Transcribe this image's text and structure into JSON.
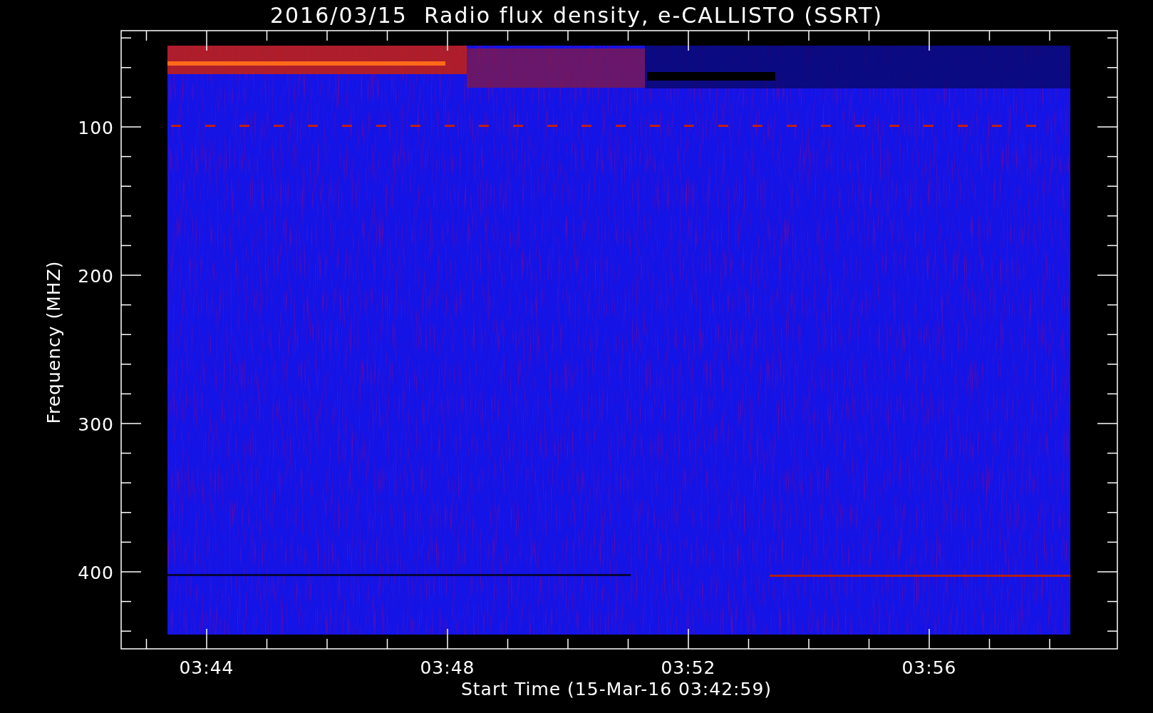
{
  "plot": {
    "title": "2016/03/15  Radio flux density, e-CALLISTO (SSRT)",
    "ylabel": "Frequency (MHZ)",
    "xlabel": "Start Time (15-Mar-16 03:42:59)",
    "yticks": [
      "100",
      "200",
      "300",
      "400"
    ],
    "xticks": [
      "03:44",
      "03:48",
      "03:52",
      "03:56"
    ]
  }
}
